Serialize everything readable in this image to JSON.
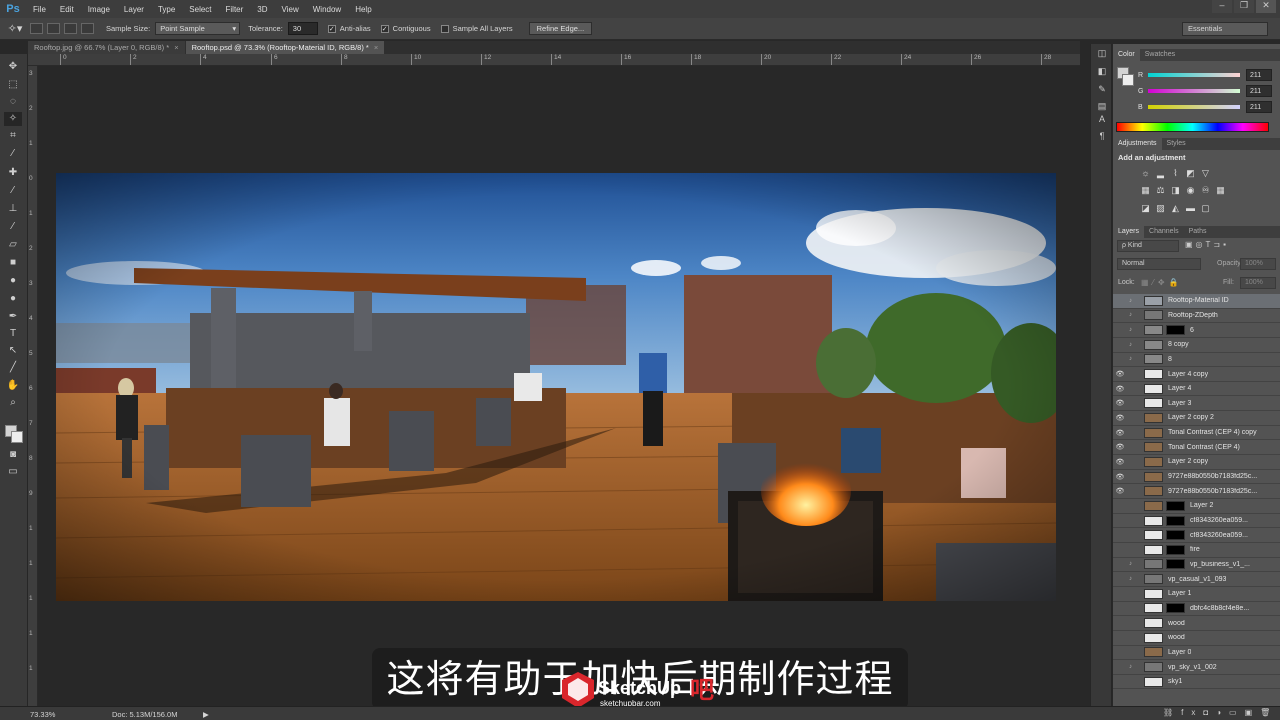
{
  "app": {
    "logo": "Ps"
  },
  "menu": [
    "File",
    "Edit",
    "Image",
    "Layer",
    "Type",
    "Select",
    "Filter",
    "3D",
    "View",
    "Window",
    "Help"
  ],
  "options": {
    "sample_size_label": "Sample Size:",
    "sample_size_value": "Point Sample",
    "tolerance_label": "Tolerance:",
    "tolerance_value": "30",
    "anti_alias": "Anti-alias",
    "contiguous": "Contiguous",
    "sample_all_layers": "Sample All Layers",
    "refine_edge": "Refine Edge...",
    "workspace": "Essentials"
  },
  "tabs": [
    {
      "label": "Rooftop.jpg @ 66.7% (Layer 0, RGB/8) *",
      "close": "×"
    },
    {
      "label": "Rooftop.psd @ 73.3% (Rooftop-Material ID, RGB/8) *",
      "close": "×"
    }
  ],
  "ruler_top": [
    "0",
    "2",
    "4",
    "6",
    "8",
    "10",
    "12",
    "14",
    "16",
    "18",
    "20",
    "22",
    "24",
    "26",
    "28"
  ],
  "ruler_left": [
    "3",
    "2",
    "1",
    "0",
    "1",
    "2",
    "3",
    "4",
    "5",
    "6",
    "7",
    "8",
    "9",
    "1",
    "1",
    "1",
    "1",
    "1",
    "1"
  ],
  "status": {
    "zoom": "73.33%",
    "doc": "Doc: 5.13M/156.0M",
    "arrow": "▶"
  },
  "color_panel": {
    "tabs": [
      "Color",
      "Swatches"
    ],
    "channels": [
      {
        "name": "R",
        "value": "211"
      },
      {
        "name": "G",
        "value": "211"
      },
      {
        "name": "B",
        "value": "211"
      }
    ]
  },
  "adjustments": {
    "tabs": [
      "Adjustments",
      "Styles"
    ],
    "title": "Add an adjustment"
  },
  "layers_panel": {
    "tabs": [
      "Layers",
      "Channels",
      "Paths"
    ],
    "kind": "ρ Kind",
    "blend": "Normal",
    "opacity_label": "Opacity:",
    "opacity_value": "100%",
    "lock_label": "Lock:",
    "fill_label": "Fill:",
    "fill_value": "100%",
    "layers": [
      {
        "name": "Rooftop-Material ID",
        "visible": false,
        "selected": true,
        "thumb": "#9aa0a8",
        "mask": false,
        "smart": true
      },
      {
        "name": "Rooftop-ZDepth",
        "visible": false,
        "selected": false,
        "thumb": "#777",
        "mask": false,
        "smart": true
      },
      {
        "name": "6",
        "visible": false,
        "selected": false,
        "thumb": "#888",
        "mask": true,
        "smart": true
      },
      {
        "name": "8 copy",
        "visible": false,
        "selected": false,
        "thumb": "#888",
        "mask": false,
        "smart": true
      },
      {
        "name": "8",
        "visible": false,
        "selected": false,
        "thumb": "#888",
        "mask": false,
        "smart": true
      },
      {
        "name": "Layer 4 copy",
        "visible": true,
        "selected": false,
        "thumb": "#e8e8e8",
        "mask": false,
        "smart": false
      },
      {
        "name": "Layer 4",
        "visible": true,
        "selected": false,
        "thumb": "#e8e8e8",
        "mask": false,
        "smart": false
      },
      {
        "name": "Layer 3",
        "visible": true,
        "selected": false,
        "thumb": "#e8e8e8",
        "mask": false,
        "smart": false
      },
      {
        "name": "Layer 2 copy 2",
        "visible": true,
        "selected": false,
        "thumb": "#8a6a4a",
        "mask": false,
        "smart": false
      },
      {
        "name": "Tonal Contrast (CEP 4) copy",
        "visible": true,
        "selected": false,
        "thumb": "#8a6a4a",
        "mask": false,
        "smart": false
      },
      {
        "name": "Tonal Contrast (CEP 4)",
        "visible": true,
        "selected": false,
        "thumb": "#8a6a4a",
        "mask": false,
        "smart": false
      },
      {
        "name": "Layer 2 copy",
        "visible": true,
        "selected": false,
        "thumb": "#8a6a4a",
        "mask": false,
        "smart": false
      },
      {
        "name": "9727e88b0550b7183fd25c...",
        "visible": true,
        "selected": false,
        "thumb": "#8a6a4a",
        "mask": false,
        "smart": false
      },
      {
        "name": "9727e88b0550b7183fd25c...",
        "visible": true,
        "selected": false,
        "thumb": "#8a6a4a",
        "mask": false,
        "smart": false
      },
      {
        "name": "Layer 2",
        "visible": false,
        "selected": false,
        "thumb": "#8a6a4a",
        "mask": true,
        "smart": false
      },
      {
        "name": "cf8343260ea059...",
        "visible": false,
        "selected": false,
        "thumb": "#e8e8e8",
        "mask": true,
        "smart": false
      },
      {
        "name": "cf8343260ea059...",
        "visible": false,
        "selected": false,
        "thumb": "#e8e8e8",
        "mask": true,
        "smart": false
      },
      {
        "name": "fire",
        "visible": false,
        "selected": false,
        "thumb": "#e8e8e8",
        "mask": true,
        "smart": false
      },
      {
        "name": "vp_business_v1_...",
        "visible": false,
        "selected": false,
        "thumb": "#777",
        "mask": true,
        "smart": true
      },
      {
        "name": "vp_casual_v1_093",
        "visible": false,
        "selected": false,
        "thumb": "#777",
        "mask": false,
        "smart": true
      },
      {
        "name": "Layer 1",
        "visible": false,
        "selected": false,
        "thumb": "#e8e8e8",
        "mask": false,
        "smart": false
      },
      {
        "name": "dbfc4c8b8cf4e8e...",
        "visible": false,
        "selected": false,
        "thumb": "#e8e8e8",
        "mask": true,
        "smart": false
      },
      {
        "name": "wood",
        "visible": false,
        "selected": false,
        "thumb": "#e8e8e8",
        "mask": false,
        "smart": false
      },
      {
        "name": "wood",
        "visible": false,
        "selected": false,
        "thumb": "#e8e8e8",
        "mask": false,
        "smart": false
      },
      {
        "name": "Layer 0",
        "visible": false,
        "selected": false,
        "thumb": "#8a6a4a",
        "mask": false,
        "smart": false
      },
      {
        "name": "vp_sky_v1_002",
        "visible": false,
        "selected": false,
        "thumb": "#777",
        "mask": false,
        "smart": true
      },
      {
        "name": "sky1",
        "visible": false,
        "selected": false,
        "thumb": "#e8e8e8",
        "mask": false,
        "smart": false
      }
    ]
  },
  "subtitle": "这将有助于加快后期制作过程",
  "watermark": {
    "brand": "SketchUp",
    "sub": "sketchupbar.com",
    "suffix": "吧"
  }
}
